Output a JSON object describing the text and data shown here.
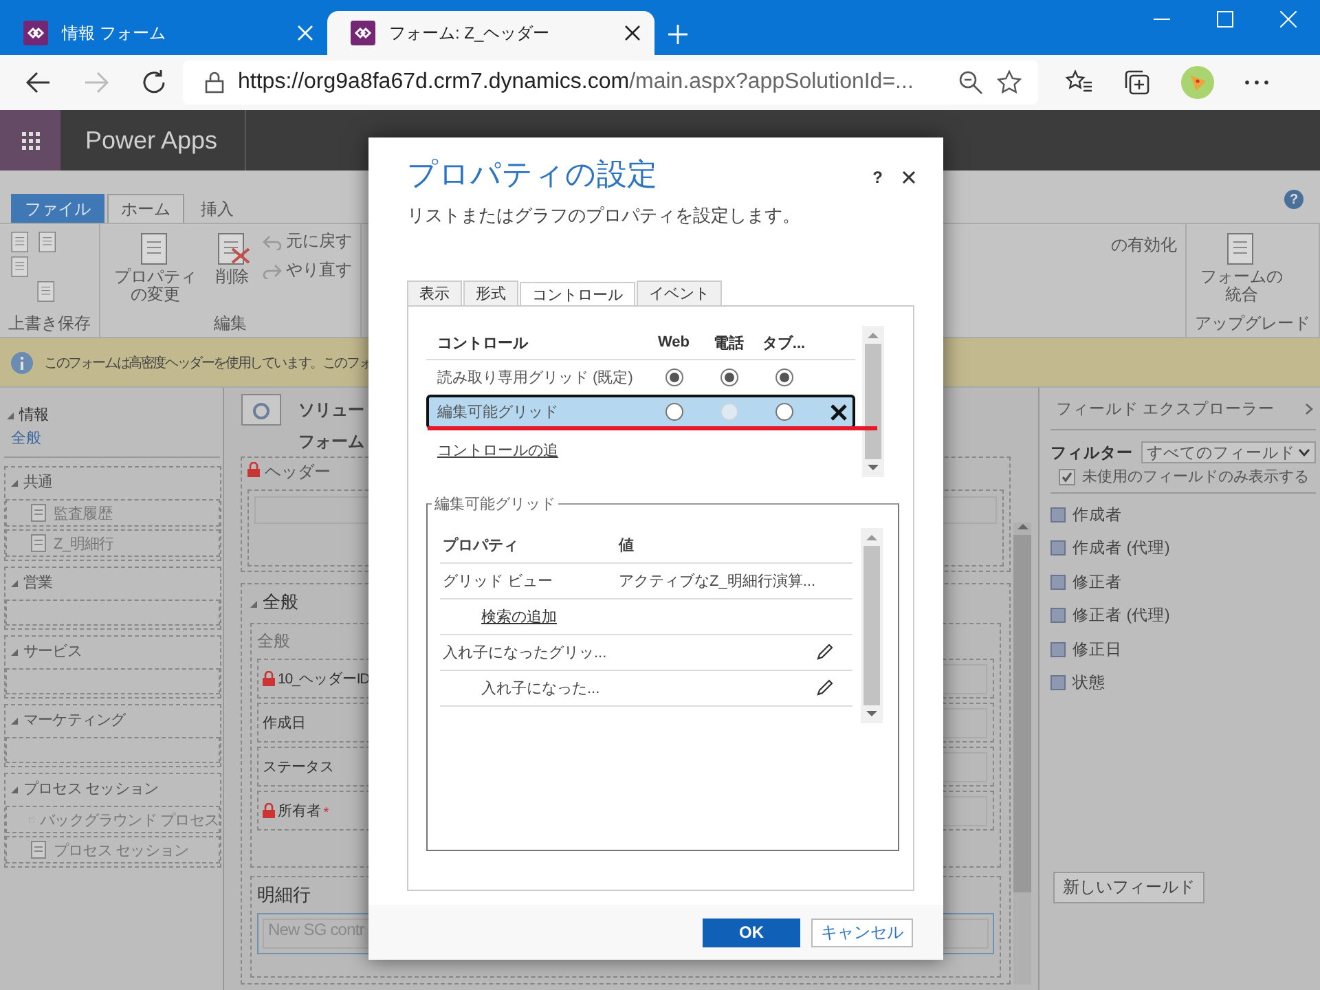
{
  "browser": {
    "tabs": [
      {
        "title": "情報 フォーム",
        "selected": false
      },
      {
        "title": "フォーム: Z_ヘッダー",
        "selected": true
      }
    ],
    "url_host": "https://org9a8fa67d.crm7.dynamics.com",
    "url_path": "/main.aspx?appSolutionId=..."
  },
  "app": {
    "name": "Power Apps"
  },
  "ribbon": {
    "tabs": [
      {
        "label": "ファイル",
        "kind": "file",
        "selected": false
      },
      {
        "label": "ホーム",
        "kind": "tab",
        "selected": true
      },
      {
        "label": "挿入",
        "kind": "tab",
        "selected": false
      }
    ],
    "help": "?",
    "groups": [
      {
        "label": "上書き保存",
        "buttons": [
          {
            "kind": "icon"
          },
          {
            "kind": "icon"
          },
          {
            "kind": "icon"
          },
          {
            "kind": "icon"
          }
        ]
      },
      {
        "label": "編集",
        "buttons": [
          {
            "label": "プロパティの変更",
            "kind": "large"
          },
          {
            "label": "削除",
            "kind": "large"
          },
          {
            "label": "元に戻す",
            "kind": "small"
          },
          {
            "label": "やり直す",
            "kind": "small"
          }
        ]
      },
      {
        "buttons": [
          {
            "label": "の有効化",
            "kind": "text"
          }
        ]
      },
      {
        "label": "アップグレード",
        "buttons": [
          {
            "label": "フォームの統合",
            "kind": "large"
          }
        ]
      }
    ]
  },
  "notification": {
    "message": "このフォームは高密度ヘッダーを使用しています。このフォ"
  },
  "nav": {
    "top": {
      "label": "情報",
      "expanded": true,
      "link": "全般"
    },
    "sections": [
      {
        "label": "共通",
        "expanded": true,
        "items": [
          "監査履歴",
          "Z_明細行"
        ]
      },
      {
        "label": "営業",
        "expanded": true
      },
      {
        "label": "サービス",
        "expanded": true
      },
      {
        "label": "マーケティング",
        "expanded": true
      },
      {
        "label": "プロセス セッション",
        "expanded": true,
        "items": [
          "バックグラウンド プロセス",
          "プロセス セッション"
        ]
      }
    ]
  },
  "form": {
    "title_1": "ソリュー",
    "title_2": "フォーム",
    "header_label": "ヘッダー",
    "tab_label": "全般",
    "section_label": "全般",
    "fields": [
      {
        "label": "10_ヘッダーID",
        "locked": true
      },
      {
        "label": "作成日",
        "locked": false
      },
      {
        "label": "ステータス",
        "locked": false
      },
      {
        "label": "所有者",
        "locked": true,
        "required_mark": "*"
      }
    ],
    "subgrid": {
      "label": "明細行",
      "control": "New SG contr"
    }
  },
  "field_explorer": {
    "title": "フィールド エクスプローラー",
    "filter_label": "フィルター",
    "filter_value": "すべてのフィールド",
    "unused_only": {
      "label": "未使用のフィールドのみ表示する",
      "checked": true
    },
    "fields": [
      "作成者",
      "作成者 (代理)",
      "修正者",
      "修正者 (代理)",
      "修正日",
      "状態"
    ],
    "new_button": "新しいフィールド"
  },
  "dialog": {
    "title": "プロパティの設定",
    "subtitle": "リストまたはグラフのプロパティを設定します。",
    "help": "?",
    "tabs": [
      {
        "label": "表示",
        "selected": false
      },
      {
        "label": "形式",
        "selected": false
      },
      {
        "label": "コントロール",
        "selected": true
      },
      {
        "label": "イベント",
        "selected": false
      }
    ],
    "controls": {
      "columns": [
        "コントロール",
        "Web",
        "電話",
        "タブ..."
      ],
      "rows": [
        {
          "name": "読み取り専用グリッド (既定)",
          "selected": false,
          "removable": false,
          "options": [
            {
              "checked": true,
              "disabled": false
            },
            {
              "checked": true,
              "disabled": false
            },
            {
              "checked": true,
              "disabled": false
            }
          ]
        },
        {
          "name": "編集可能グリッド",
          "selected": true,
          "removable": true,
          "options": [
            {
              "checked": false,
              "disabled": false
            },
            {
              "checked": false,
              "disabled": true
            },
            {
              "checked": false,
              "disabled": false
            }
          ]
        }
      ],
      "add_link": "コントロールの追"
    },
    "properties": {
      "legend": "編集可能グリッド",
      "columns": [
        "プロパティ",
        "値"
      ],
      "rows": [
        {
          "kind": "plain",
          "property": "グリッド ビュー",
          "value": "アクティブなZ_明細行演算...",
          "editable": false
        },
        {
          "kind": "link",
          "property": "検索の追加",
          "editable": false
        },
        {
          "kind": "plain",
          "property": "入れ子になったグリッ...",
          "editable": true
        },
        {
          "kind": "nested",
          "property": "入れ子になった...",
          "editable": true
        }
      ]
    },
    "buttons": [
      {
        "label": "OK",
        "kind": "primary"
      },
      {
        "label": "キャンセル",
        "kind": "secondary"
      }
    ]
  }
}
